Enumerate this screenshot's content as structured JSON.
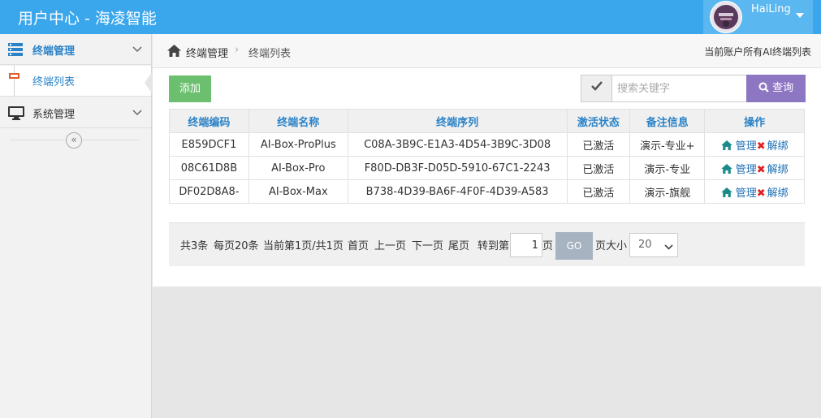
{
  "header": {
    "title": "用户中心 - 海凌智能",
    "username": "HaiLing"
  },
  "sidebar": {
    "groups": [
      {
        "label": "终端管理",
        "icon": "server-icon",
        "expanded": true,
        "items": [
          {
            "label": "终端列表",
            "active": true
          }
        ]
      },
      {
        "label": "系统管理",
        "icon": "monitor-icon",
        "expanded": false
      }
    ],
    "collapse_glyph": "«"
  },
  "breadcrumb": {
    "items": [
      "终端管理",
      "终端列表"
    ],
    "separator": "›",
    "right_text": "当前账户所有AI终端列表"
  },
  "toolbar": {
    "add_label": "添加",
    "search_placeholder": "搜索关键字",
    "search_value": "",
    "search_button": "查询"
  },
  "table": {
    "columns": [
      "终端编码",
      "终端名称",
      "终端序列",
      "激活状态",
      "备注信息",
      "操作"
    ],
    "rows": [
      {
        "code": "E859DCF1",
        "name": "AI-Box-ProPlus",
        "serial": "C08A-3B9C-E1A3-4D54-3B9C-3D08",
        "status": "已激活",
        "remark": "演示-专业+",
        "manage": "管理",
        "unbind": "解绑"
      },
      {
        "code": "08C61D8B",
        "name": "AI-Box-Pro",
        "serial": "F80D-DB3F-D05D-5910-67C1-2243",
        "status": "已激活",
        "remark": "演示-专业",
        "manage": "管理",
        "unbind": "解绑"
      },
      {
        "code": "DF02D8A8-",
        "name": "AI-Box-Max",
        "serial": "B738-4D39-BA6F-4F0F-4D39-A583",
        "status": "已激活",
        "remark": "演示-旗舰",
        "manage": "管理",
        "unbind": "解绑"
      }
    ]
  },
  "pager": {
    "total": "共3条",
    "per_page": "每页20条",
    "current": "当前第1页/共1页",
    "first": "首页",
    "prev": "上一页",
    "next": "下一页",
    "last": "尾页",
    "goto_label": "转到第",
    "goto_value": "1",
    "page_unit": "页",
    "go_label": "GO",
    "size_label": "页大小",
    "size_value": "20"
  },
  "colors": {
    "topbar": "#3aa6ec",
    "accent": "#2a82c7",
    "add_button": "#6bbf6e",
    "search_button": "#8d77c3",
    "go_button": "#a7b3c0",
    "unbind_icon": "#e02020",
    "manage_icon": "#1a8a8a"
  }
}
